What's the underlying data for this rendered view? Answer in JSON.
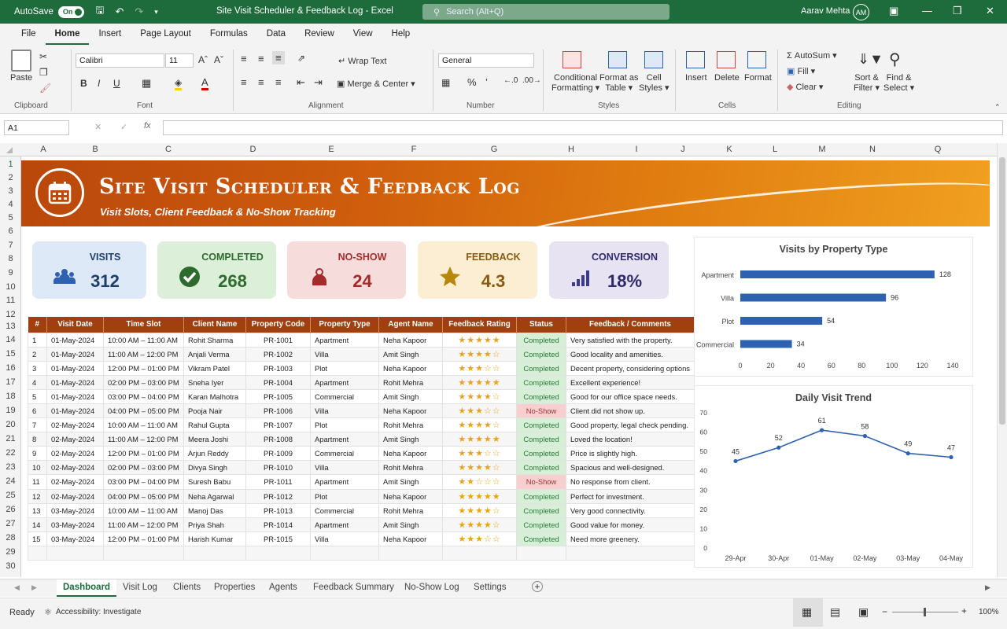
{
  "titlebar": {
    "autosave": "AutoSave",
    "toggle": "On",
    "doc_title": "Site Visit Scheduler & Feedback Log  -  Excel",
    "search": "Search (Alt+Q)",
    "user": "Aarav Mehta",
    "initials": "AM"
  },
  "menu": [
    "File",
    "Home",
    "Insert",
    "Page Layout",
    "Formulas",
    "Data",
    "Review",
    "View",
    "Help"
  ],
  "ribbon": {
    "paste": "Paste",
    "clipboard": "Clipboard",
    "font_name": "Calibri",
    "font_size": "11",
    "font": "Font",
    "wrap": "Wrap Text",
    "merge": "Merge & Center",
    "alignment": "Alignment",
    "number_format": "General",
    "number": "Number",
    "cond1": "Conditional",
    "cond2": "Formatting",
    "fmt1": "Format as",
    "fmt2": "Table",
    "cell1": "Cell",
    "cell2": "Styles",
    "styles": "Styles",
    "insert": "Insert",
    "delete": "Delete",
    "format": "Format",
    "cells": "Cells",
    "autosum": "AutoSum",
    "fill": "Fill",
    "clear": "Clear",
    "sort1": "Sort &",
    "sort2": "Filter",
    "find1": "Find &",
    "find2": "Select",
    "editing": "Editing"
  },
  "formula": {
    "namebox": "A1",
    "fx": "fx"
  },
  "columns": [
    "A",
    "B",
    "C",
    "D",
    "E",
    "F",
    "G",
    "H",
    "I",
    "J",
    "K",
    "L",
    "M",
    "N",
    "Q"
  ],
  "rows": [
    "1",
    "2",
    "3",
    "4",
    "5",
    "6",
    "7",
    "8",
    "9",
    "10",
    "11",
    "12",
    "13",
    "14",
    "15",
    "16",
    "17",
    "18",
    "19",
    "20",
    "21",
    "22",
    "23",
    "24",
    "25",
    "26",
    "27",
    "28",
    "29",
    "30"
  ],
  "banner": {
    "title": "Site Visit Scheduler & Feedback Log",
    "subtitle": "Visit Slots, Client Feedback & No-Show Tracking"
  },
  "kpis": [
    {
      "label": "VISITS",
      "value": "312",
      "bg": "#dde9f6",
      "color": "#1f3f6b",
      "icon": "people-icon"
    },
    {
      "label": "COMPLETED",
      "value": "268",
      "bg": "#dcefd8",
      "color": "#2e6b2e",
      "icon": "check-circle-icon"
    },
    {
      "label": "NO-SHOW",
      "value": "24",
      "bg": "#f7dcdc",
      "color": "#a32b2b",
      "icon": "person-cancel-icon"
    },
    {
      "label": "FEEDBACK",
      "value": "4.3",
      "bg": "#fbeed3",
      "color": "#8a5a10",
      "icon": "star-icon"
    },
    {
      "label": "CONVERSION",
      "value": "18%",
      "bg": "#e7e3f2",
      "color": "#2d2a6b",
      "icon": "bar-chart-icon"
    }
  ],
  "table": {
    "headers": [
      "#",
      "Visit Date",
      "Time Slot",
      "Client Name",
      "Property Code",
      "Property Type",
      "Agent Name",
      "Feedback Rating",
      "Status",
      "Feedback / Comments"
    ],
    "rows": [
      [
        "1",
        "01-May-2024",
        "10:00 AM – 11:00 AM",
        "Rohit Sharma",
        "PR-1001",
        "Apartment",
        "Neha Kapoor",
        "★★★★★",
        "Completed",
        "Very satisfied with the property."
      ],
      [
        "2",
        "01-May-2024",
        "11:00 AM – 12:00 PM",
        "Anjali Verma",
        "PR-1002",
        "Villa",
        "Amit Singh",
        "★★★★☆",
        "Completed",
        "Good locality and amenities."
      ],
      [
        "3",
        "01-May-2024",
        "12:00 PM – 01:00 PM",
        "Vikram Patel",
        "PR-1003",
        "Plot",
        "Neha Kapoor",
        "★★★☆☆",
        "Completed",
        "Decent property, considering options"
      ],
      [
        "4",
        "01-May-2024",
        "02:00 PM – 03:00 PM",
        "Sneha Iyer",
        "PR-1004",
        "Apartment",
        "Rohit Mehra",
        "★★★★★",
        "Completed",
        "Excellent experience!"
      ],
      [
        "5",
        "01-May-2024",
        "03:00 PM – 04:00 PM",
        "Karan Malhotra",
        "PR-1005",
        "Commercial",
        "Amit Singh",
        "★★★★☆",
        "Completed",
        "Good for our office space needs."
      ],
      [
        "6",
        "01-May-2024",
        "04:00 PM – 05:00 PM",
        "Pooja Nair",
        "PR-1006",
        "Villa",
        "Neha Kapoor",
        "★★★☆☆",
        "No-Show",
        "Client did not show up."
      ],
      [
        "7",
        "02-May-2024",
        "10:00 AM – 11:00 AM",
        "Rahul Gupta",
        "PR-1007",
        "Plot",
        "Rohit Mehra",
        "★★★★☆",
        "Completed",
        "Good property, legal check pending."
      ],
      [
        "8",
        "02-May-2024",
        "11:00 AM – 12:00 PM",
        "Meera Joshi",
        "PR-1008",
        "Apartment",
        "Amit Singh",
        "★★★★★",
        "Completed",
        "Loved the location!"
      ],
      [
        "9",
        "02-May-2024",
        "12:00 PM – 01:00 PM",
        "Arjun Reddy",
        "PR-1009",
        "Commercial",
        "Neha Kapoor",
        "★★★☆☆",
        "Completed",
        "Price is slightly high."
      ],
      [
        "10",
        "02-May-2024",
        "02:00 PM – 03:00 PM",
        "Divya Singh",
        "PR-1010",
        "Villa",
        "Rohit Mehra",
        "★★★★☆",
        "Completed",
        "Spacious and well-designed."
      ],
      [
        "11",
        "02-May-2024",
        "03:00 PM – 04:00 PM",
        "Suresh Babu",
        "PR-1011",
        "Apartment",
        "Amit Singh",
        "★★☆☆☆",
        "No-Show",
        "No response from client."
      ],
      [
        "12",
        "02-May-2024",
        "04:00 PM – 05:00 PM",
        "Neha Agarwal",
        "PR-1012",
        "Plot",
        "Neha Kapoor",
        "★★★★★",
        "Completed",
        "Perfect for investment."
      ],
      [
        "13",
        "03-May-2024",
        "10:00 AM – 11:00 AM",
        "Manoj Das",
        "PR-1013",
        "Commercial",
        "Rohit Mehra",
        "★★★★☆",
        "Completed",
        "Very good connectivity."
      ],
      [
        "14",
        "03-May-2024",
        "11:00 AM – 12:00 PM",
        "Priya Shah",
        "PR-1014",
        "Apartment",
        "Amit Singh",
        "★★★★☆",
        "Completed",
        "Good value for money."
      ],
      [
        "15",
        "03-May-2024",
        "12:00 PM – 01:00 PM",
        "Harish Kumar",
        "PR-1015",
        "Villa",
        "Neha Kapoor",
        "★★★☆☆",
        "Completed",
        "Need more greenery."
      ]
    ]
  },
  "chart_data": [
    {
      "type": "bar",
      "title": "Visits by Property Type",
      "categories": [
        "Apartment",
        "Villa",
        "Plot",
        "Commercial"
      ],
      "values": [
        128,
        96,
        54,
        34
      ],
      "xlim": [
        0,
        140
      ],
      "xticks": [
        "0",
        "20",
        "40",
        "60",
        "80",
        "100",
        "120",
        "140"
      ],
      "color": "#2e62b0"
    },
    {
      "type": "line",
      "title": "Daily Visit Trend",
      "categories": [
        "29-Apr",
        "30-Apr",
        "01-May",
        "02-May",
        "03-May",
        "04-May"
      ],
      "values": [
        45,
        52,
        61,
        58,
        49,
        47
      ],
      "ylim": [
        0,
        70
      ],
      "yticks": [
        "0",
        "10",
        "20",
        "30",
        "40",
        "50",
        "60",
        "70"
      ],
      "color": "#2e62b0"
    }
  ],
  "sheet_tabs": [
    "Dashboard",
    "Visit Log",
    "Clients",
    "Properties",
    "Agents",
    "Feedback Summary",
    "No-Show Log",
    "Settings"
  ],
  "status": {
    "ready": "Ready",
    "accessibility": "Accessibility: Investigate",
    "zoom": "100%"
  }
}
